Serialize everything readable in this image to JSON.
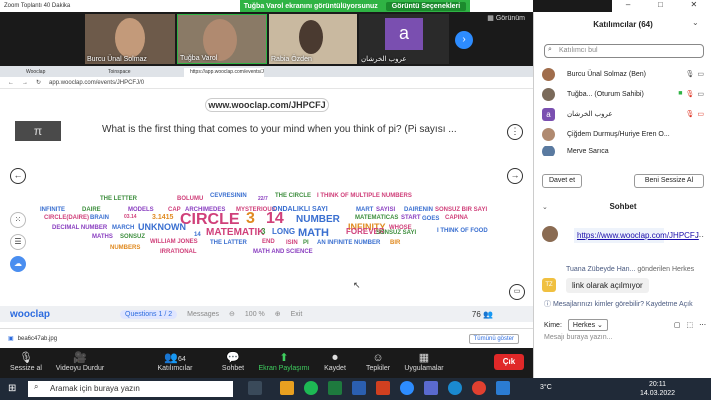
{
  "window": {
    "title": "Zoom Toplantı 40 Dakika"
  },
  "share_bar": {
    "text": "Tuğba Varol ekranını görüntülüyorsunuz",
    "options_label": "Görüntü Seçenekleri"
  },
  "gallery": {
    "label": "Görünüm"
  },
  "video_tiles": [
    {
      "name": "Burcu Ünal Solmaz"
    },
    {
      "name": "Tuğba Varol"
    },
    {
      "name": "Rabia Özden"
    },
    {
      "name": "عروب الخرشان",
      "avatar_letter": "a"
    }
  ],
  "browser": {
    "tabs": [
      "Wooclap",
      "Toinspace",
      "https://app.wooclap.com/events/JHPCFJ/0"
    ],
    "address": "app.wooclap.com/events/JHPCFJ/0"
  },
  "wooclap": {
    "url_pill": "www.wooclap.com/JHPCFJ",
    "question": "What is the first thing that comes to your mind when you think of pi? (Pi sayısı ...",
    "logo": "wooclap",
    "questions_label": "Questions",
    "question_counter": "1 / 2",
    "messages_label": "Messages",
    "zoom_level": "100 %",
    "exit_label": "Exit",
    "participant_count": "76"
  },
  "word_cloud": [
    {
      "text": "THE LETTER",
      "color": "#3f8f3f"
    },
    {
      "text": "BOLUMU",
      "color": "#d0407a"
    },
    {
      "text": "CEVRESININ",
      "color": "#3a6fd0"
    },
    {
      "text": "22/7",
      "color": "#8a3fc0"
    },
    {
      "text": "THE CIRCLE",
      "color": "#3f8f3f"
    },
    {
      "text": "I THINK OF MULTIPLE NUMBERS",
      "color": "#d0407a"
    },
    {
      "text": "INFINITE",
      "color": "#3a6fd0"
    },
    {
      "text": "DAIRE",
      "color": "#3f8f3f"
    },
    {
      "text": "MODELS",
      "color": "#8a3fc0"
    },
    {
      "text": "CAP",
      "color": "#d0407a"
    },
    {
      "text": "ARCHIMEDES",
      "color": "#8a3fc0"
    },
    {
      "text": "MYSTERIOUS",
      "color": "#d0407a"
    },
    {
      "text": "ONDALIKLI SAYI",
      "color": "#3a6fd0"
    },
    {
      "text": "MART",
      "color": "#3a6fd0"
    },
    {
      "text": "SAYISI",
      "color": "#8a3fc0"
    },
    {
      "text": "DAIRENIN",
      "color": "#3a6fd0"
    },
    {
      "text": "SONSUZ BIR SAYI",
      "color": "#d0407a"
    },
    {
      "text": "CIRCLE(DAIRE)",
      "color": "#d0407a"
    },
    {
      "text": "BRAIN",
      "color": "#3a6fd0"
    },
    {
      "text": "03.14",
      "color": "#d0407a"
    },
    {
      "text": "3.1415",
      "color": "#e08a20"
    },
    {
      "text": "CIRCLE",
      "color": "#d0407a"
    },
    {
      "text": "3",
      "color": "#e08a20"
    },
    {
      "text": "14",
      "color": "#d0407a"
    },
    {
      "text": "NUMBER",
      "color": "#3a6fd0"
    },
    {
      "text": "MATEMATICAS",
      "color": "#3f8f3f"
    },
    {
      "text": "START",
      "color": "#8a3fc0"
    },
    {
      "text": "GOES",
      "color": "#3a6fd0"
    },
    {
      "text": "CAPINA",
      "color": "#d0407a"
    },
    {
      "text": "DECIMAL NUMBER",
      "color": "#8a3fc0"
    },
    {
      "text": "MARCH",
      "color": "#3a6fd0"
    },
    {
      "text": "UNKNOWN",
      "color": "#3a6fd0"
    },
    {
      "text": "MATEMATIK",
      "color": "#d0407a"
    },
    {
      "text": "3",
      "color": "#3f8f3f"
    },
    {
      "text": "LONG",
      "color": "#3a6fd0"
    },
    {
      "text": "MATH",
      "color": "#3a6fd0"
    },
    {
      "text": "INFINITY",
      "color": "#e08a20"
    },
    {
      "text": "WHOSE",
      "color": "#d0407a"
    },
    {
      "text": "I THINK OF FOOD",
      "color": "#3a6fd0"
    },
    {
      "text": "MATHS",
      "color": "#8a3fc0"
    },
    {
      "text": "SONSUZ",
      "color": "#3f8f3f"
    },
    {
      "text": "14",
      "color": "#3a6fd0"
    },
    {
      "text": "END",
      "color": "#d0407a"
    },
    {
      "text": "FOREVER",
      "color": "#d0407a"
    },
    {
      "text": "SONSUZ SAYI",
      "color": "#3f8f3f"
    },
    {
      "text": "NUMBERS",
      "color": "#e08a20"
    },
    {
      "text": "WILLIAM JONES",
      "color": "#d0407a"
    },
    {
      "text": "THE LATTER",
      "color": "#3a6fd0"
    },
    {
      "text": "ISIN",
      "color": "#d0407a"
    },
    {
      "text": "PI",
      "color": "#3f8f3f"
    },
    {
      "text": "AN INFINITE NUMBER",
      "color": "#3a6fd0"
    },
    {
      "text": "BIR",
      "color": "#e08a20"
    },
    {
      "text": "IRRATIONAL",
      "color": "#d0407a"
    },
    {
      "text": "MATH AND SCIENCE",
      "color": "#8a3fc0"
    }
  ],
  "download_bar": {
    "file": "bea6c47ab.jpg",
    "show_all": "Tümünü göster"
  },
  "controls": {
    "mute": "Sessize al",
    "video": "Videoyu Durdur",
    "participants": "Katılımcılar",
    "participants_count": "64",
    "chat": "Sohbet",
    "share": "Ekran Paylaşımı",
    "record": "Kaydet",
    "reactions": "Tepkiler",
    "apps": "Uygulamalar",
    "leave": "Çık"
  },
  "panel": {
    "title": "Katılımcılar (64)",
    "search_placeholder": "Katılımcı bul",
    "participants": [
      {
        "name": "Burcu Ünal Solmaz (Ben)"
      },
      {
        "name": "Tuğba... (Oturum Sahibi)"
      },
      {
        "name": "عروب الخرشان",
        "avatar_letter": "a"
      },
      {
        "name": "Çiğdem Durmuş/Huriye Eren O..."
      },
      {
        "name": "Merve Sarıca"
      }
    ],
    "invite": "Davet et",
    "mute_all": "Beni Sessize Al",
    "chat_title": "Sohbet",
    "chat_link": "https://www.wooclap.com/JHPCFJ",
    "msg_sender": "Tuana Zübeyde Han...",
    "msg_sender_suffix": "gönderilen Herkes",
    "msg_avatar": "TZ",
    "msg_text": "link olarak açılmıyor",
    "who_can_see": "Mesajlarınızı kimler görebilir? Kaydetme Açık",
    "to_label": "Kime:",
    "to_value": "Herkes",
    "input_placeholder": "Mesajı buraya yazın..."
  },
  "taskbar": {
    "search": "Aramak için buraya yazın",
    "temp": "3°C",
    "time": "20:11",
    "date": "14.03.2022"
  }
}
